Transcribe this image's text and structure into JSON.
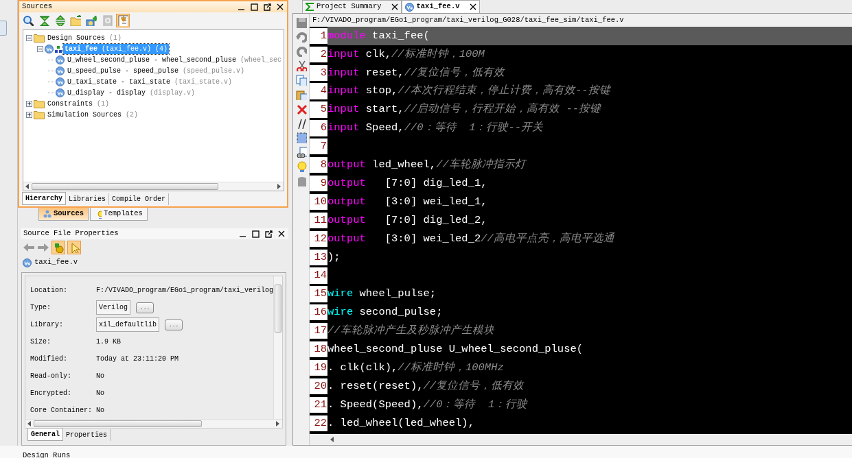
{
  "sources_panel": {
    "title": "Sources",
    "tree": [
      {
        "kind": "folder",
        "label": "Design Sources",
        "detail": "(1)",
        "expanded": true,
        "selected": false,
        "children": [
          {
            "kind": "top",
            "label": "taxi_fee",
            "detail": "(taxi_fee.v) (4)",
            "expanded": true,
            "selected": true,
            "children": [
              {
                "kind": "verilog",
                "label": "U_wheel_second_pluse - wheel_second_pluse",
                "detail": "(wheel_sec",
                "selected": false
              },
              {
                "kind": "verilog",
                "label": "U_speed_pulse - speed_pulse",
                "detail": "(speed_pulse.v)",
                "selected": false
              },
              {
                "kind": "verilog",
                "label": "U_taxi_state - taxi_state",
                "detail": "(taxi_state.v)",
                "selected": false
              },
              {
                "kind": "verilog",
                "label": "U_display - display",
                "detail": "(display.v)",
                "selected": false
              }
            ]
          }
        ]
      },
      {
        "kind": "folder",
        "label": "Constraints",
        "detail": "(1)",
        "expanded": false,
        "selected": false
      },
      {
        "kind": "folder",
        "label": "Simulation Sources",
        "detail": "(2)",
        "expanded": false,
        "selected": false
      }
    ],
    "tabs": [
      {
        "label": "Hierarchy",
        "selected": true
      },
      {
        "label": "Libraries",
        "selected": false
      },
      {
        "label": "Compile Order",
        "selected": false
      }
    ]
  },
  "dock_tabs": [
    {
      "label": "Sources",
      "kind": "sources",
      "selected": true
    },
    {
      "label": "Templates",
      "kind": "templates",
      "selected": false
    }
  ],
  "properties_panel": {
    "title": "Source File Properties",
    "file": "taxi_fee.v",
    "properties": [
      {
        "label": "Location:",
        "value": "F:/VIVADO_program/EGo1_program/taxi_verilog",
        "kind": "text"
      },
      {
        "label": "Type:",
        "value": "Verilog",
        "kind": "field",
        "button": "..."
      },
      {
        "label": "Library:",
        "value": "xil_defaultlib",
        "kind": "field",
        "button": "..."
      },
      {
        "label": "Size:",
        "value": "1.9 KB",
        "kind": "text"
      },
      {
        "label": "Modified:",
        "value": "Today at 23:11:20 PM",
        "kind": "text"
      },
      {
        "label": "Read-only:",
        "value": "No",
        "kind": "text"
      },
      {
        "label": "Encrypted:",
        "value": "No",
        "kind": "text"
      },
      {
        "label": "Core Container:",
        "value": "No",
        "kind": "text"
      }
    ],
    "tabs": [
      {
        "label": "General",
        "selected": true
      },
      {
        "label": "Properties",
        "selected": false
      }
    ]
  },
  "editor": {
    "tabs": [
      {
        "label": "Project Summary",
        "kind": "summary",
        "selected": false
      },
      {
        "label": "taxi_fee.v",
        "kind": "verilog",
        "selected": true
      }
    ],
    "path": "F:/VIVADO_program/EGo1_program/taxi_verilog_G028/taxi_fee_sim/taxi_fee.v",
    "lines": [
      {
        "number": "1",
        "highlighted": true,
        "tokens": [
          {
            "kind": "keyword",
            "text": "module"
          },
          {
            "kind": "code",
            "text": " taxi_fee("
          }
        ]
      },
      {
        "number": "2",
        "highlighted": false,
        "tokens": [
          {
            "kind": "keyword",
            "text": "input"
          },
          {
            "kind": "code",
            "text": " clk,"
          },
          {
            "kind": "comment",
            "text": "//标准时钟，100M"
          }
        ]
      },
      {
        "number": "3",
        "highlighted": false,
        "tokens": [
          {
            "kind": "keyword",
            "text": "input"
          },
          {
            "kind": "code",
            "text": " reset,"
          },
          {
            "kind": "comment",
            "text": "//复位信号，低有效"
          }
        ]
      },
      {
        "number": "4",
        "highlighted": false,
        "tokens": [
          {
            "kind": "keyword",
            "text": "input"
          },
          {
            "kind": "code",
            "text": " stop,"
          },
          {
            "kind": "comment",
            "text": "//本次行程结束，停止计费，高有效--按键"
          }
        ]
      },
      {
        "number": "5",
        "highlighted": false,
        "tokens": [
          {
            "kind": "keyword",
            "text": "input"
          },
          {
            "kind": "code",
            "text": " start,"
          },
          {
            "kind": "comment",
            "text": "//启动信号，行程开始，高有效 --按键"
          }
        ]
      },
      {
        "number": "6",
        "highlighted": false,
        "tokens": [
          {
            "kind": "keyword",
            "text": "input"
          },
          {
            "kind": "code",
            "text": " Speed,"
          },
          {
            "kind": "comment",
            "text": "//0：等待  1：行驶--开关"
          }
        ]
      },
      {
        "number": "7",
        "highlighted": false
      },
      {
        "number": "8",
        "highlighted": false,
        "tokens": [
          {
            "kind": "keyword",
            "text": "output"
          },
          {
            "kind": "code",
            "text": " led_wheel,"
          },
          {
            "kind": "comment",
            "text": "//车轮脉冲指示灯"
          }
        ]
      },
      {
        "number": "9",
        "highlighted": false,
        "tokens": [
          {
            "kind": "keyword",
            "text": "output"
          },
          {
            "kind": "code",
            "text": "   [7:0] dig_led_1,"
          }
        ]
      },
      {
        "number": "10",
        "highlighted": false,
        "tokens": [
          {
            "kind": "keyword",
            "text": "output"
          },
          {
            "kind": "code",
            "text": "   [3:0] wei_led_1,"
          }
        ]
      },
      {
        "number": "11",
        "highlighted": false,
        "tokens": [
          {
            "kind": "keyword",
            "text": "output"
          },
          {
            "kind": "code",
            "text": "   [7:0] dig_led_2,"
          }
        ]
      },
      {
        "number": "12",
        "highlighted": false,
        "tokens": [
          {
            "kind": "keyword",
            "text": "output"
          },
          {
            "kind": "code",
            "text": "   [3:0] wei_led_2"
          },
          {
            "kind": "comment",
            "text": "//高电平点亮，高电平选通"
          }
        ]
      },
      {
        "number": "13",
        "highlighted": false,
        "tokens": [
          {
            "kind": "code",
            "text": ");"
          }
        ]
      },
      {
        "number": "14",
        "highlighted": false
      },
      {
        "number": "15",
        "highlighted": false,
        "tokens": [
          {
            "kind": "type",
            "text": "wire"
          },
          {
            "kind": "code",
            "text": " wheel_pulse;"
          }
        ]
      },
      {
        "number": "16",
        "highlighted": false,
        "tokens": [
          {
            "kind": "type",
            "text": "wire"
          },
          {
            "kind": "code",
            "text": " second_pulse;"
          }
        ]
      },
      {
        "number": "17",
        "highlighted": false,
        "tokens": [
          {
            "kind": "comment",
            "text": "//车轮脉冲产生及秒脉冲产生模块"
          }
        ]
      },
      {
        "number": "18",
        "highlighted": false,
        "tokens": [
          {
            "kind": "code",
            "text": "wheel_second_pluse U_wheel_second_pluse("
          }
        ]
      },
      {
        "number": "19",
        "highlighted": false,
        "tokens": [
          {
            "kind": "code",
            "text": ". clk(clk),"
          },
          {
            "kind": "comment",
            "text": "//标准时钟，100MHz"
          }
        ]
      },
      {
        "number": "20",
        "highlighted": false,
        "tokens": [
          {
            "kind": "code",
            "text": ". reset(reset),"
          },
          {
            "kind": "comment",
            "text": "//复位信号，低有效"
          }
        ]
      },
      {
        "number": "21",
        "highlighted": false,
        "tokens": [
          {
            "kind": "code",
            "text": ". Speed(Speed),"
          },
          {
            "kind": "comment",
            "text": "//0：等待  1：行驶"
          }
        ]
      },
      {
        "number": "22",
        "highlighted": false,
        "tokens": [
          {
            "kind": "code",
            "text": ". led_wheel(led_wheel),"
          }
        ]
      }
    ]
  },
  "bottom_panel": {
    "title": "Design Runs"
  }
}
